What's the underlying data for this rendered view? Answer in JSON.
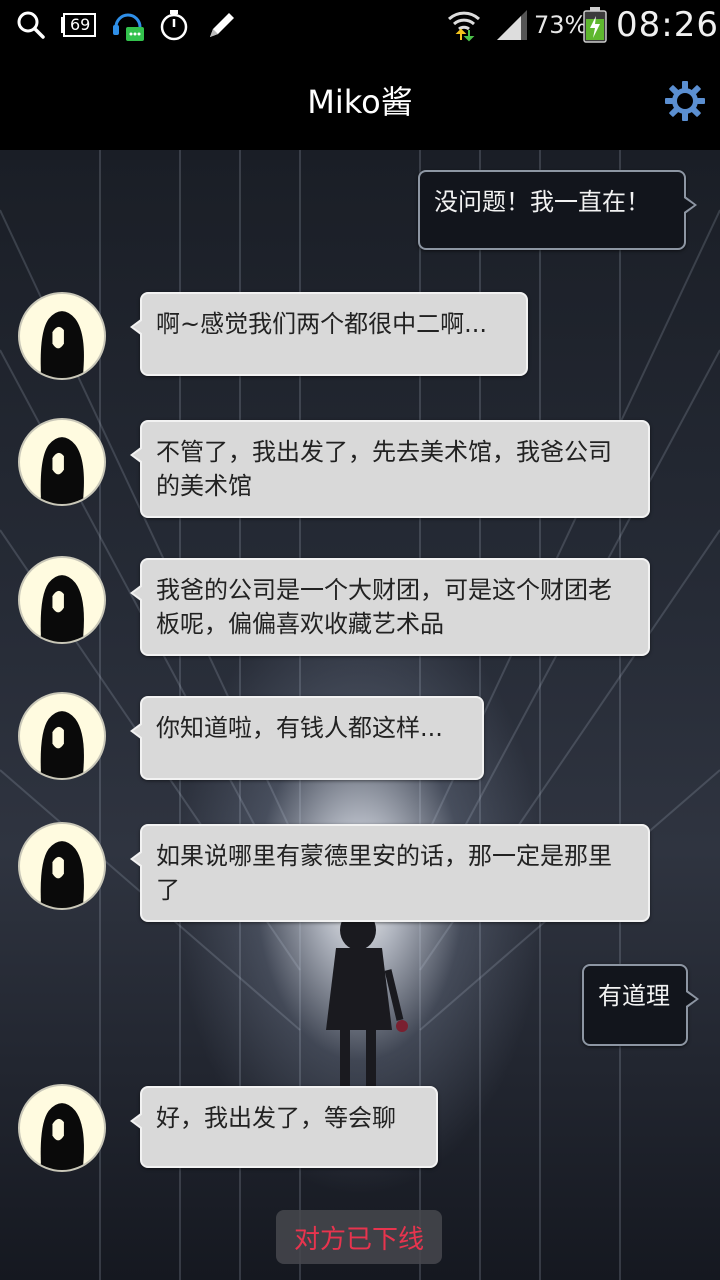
{
  "status_bar": {
    "notification_count": "69",
    "battery_percent": "73%",
    "time": "08:26",
    "icons": [
      "search-icon",
      "notification-count-icon",
      "chat-support-icon",
      "stopwatch-icon",
      "pencil-icon",
      "wifi-icon",
      "signal-icon",
      "battery-charging-icon"
    ]
  },
  "header": {
    "title": "Miko酱",
    "settings_icon": "gear-icon"
  },
  "colors": {
    "status_bar_bg": "#000000",
    "header_bg": "#000000",
    "incoming_bubble": "#d9d9d9",
    "outgoing_bubble": "#12151c",
    "gear_accent": "#5b8fd1",
    "offline_text": "#e8344e",
    "avatar_bg": "#fffbe0"
  },
  "messages": [
    {
      "direction": "outgoing",
      "text": "没问题！我一直在！"
    },
    {
      "direction": "incoming",
      "text": "啊~感觉我们两个都很中二啊..."
    },
    {
      "direction": "incoming",
      "text": "不管了，我出发了，先去美术馆，我爸公司的美术馆"
    },
    {
      "direction": "incoming",
      "text": "我爸的公司是一个大财团，可是这个财团老板呢，偏偏喜欢收藏艺术品"
    },
    {
      "direction": "incoming",
      "text": "你知道啦，有钱人都这样..."
    },
    {
      "direction": "incoming",
      "text": "如果说哪里有蒙德里安的话，那一定是那里了"
    },
    {
      "direction": "outgoing",
      "text": "有道理"
    },
    {
      "direction": "incoming",
      "text": "好，我出发了，等会聊"
    }
  ],
  "system": {
    "offline_notice": "对方已下线"
  }
}
